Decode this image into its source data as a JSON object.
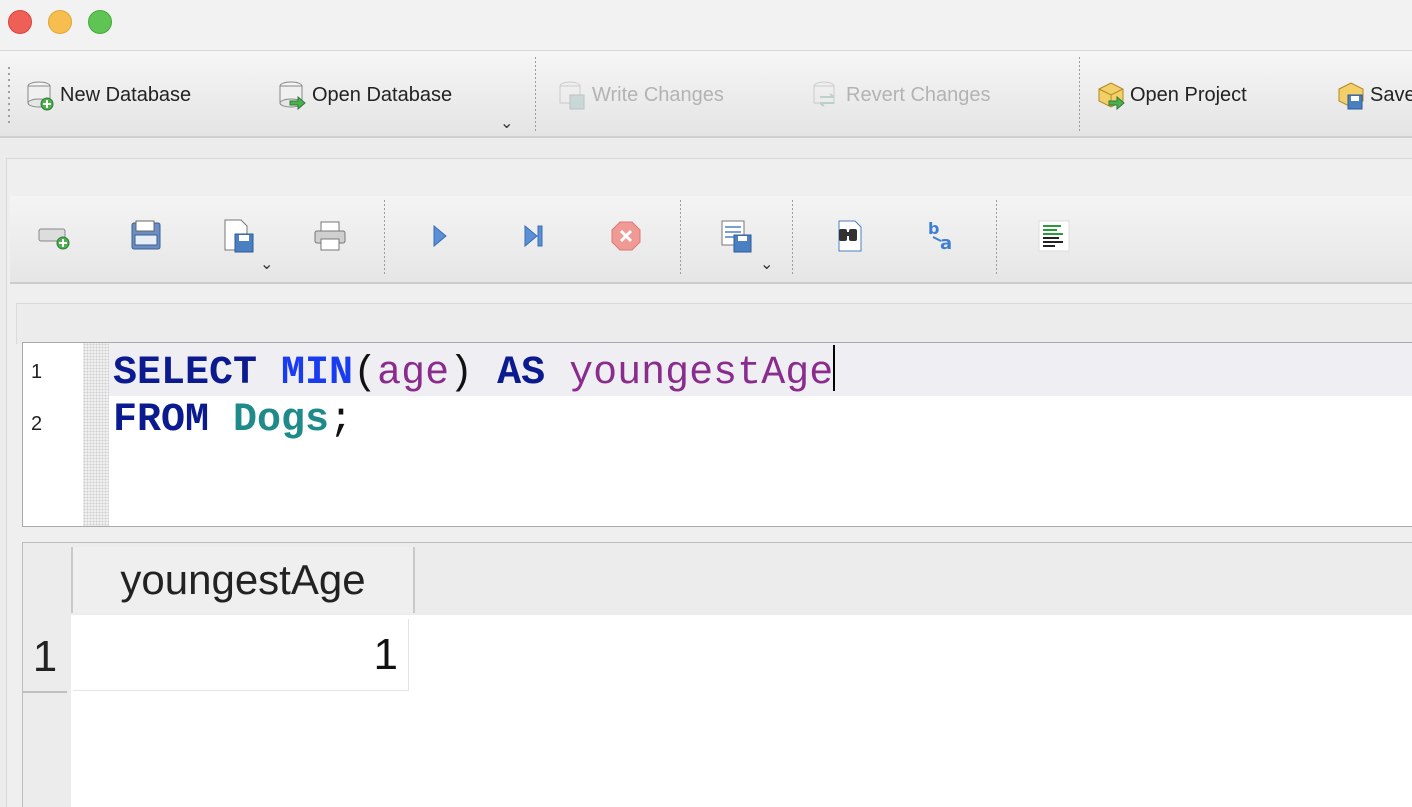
{
  "window": {
    "buttons": [
      "close",
      "minimize",
      "maximize"
    ]
  },
  "main_toolbar": {
    "new_database": "New Database",
    "open_database": "Open Database",
    "write_changes": "Write Changes",
    "revert_changes": "Revert Changes",
    "open_project": "Open Project",
    "save_project": "Save"
  },
  "sql_toolbar": {
    "icons": [
      "open-tab-icon",
      "open-sql-file-icon",
      "save-sql-file-icon",
      "print-icon",
      "execute-all-icon",
      "execute-line-icon",
      "stop-execution-icon",
      "save-results-icon",
      "find-icon",
      "find-replace-icon",
      "comment-icon"
    ]
  },
  "editor": {
    "line_numbers": [
      "1",
      "2"
    ],
    "line1": {
      "kw1": "SELECT",
      "fn": "MIN",
      "lp": "(",
      "arg": "age",
      "rp": ")",
      "kw2": "AS",
      "alias": "youngestAge"
    },
    "line2": {
      "kw": "FROM",
      "table": "Dogs",
      "semi": ";"
    }
  },
  "results": {
    "columns": [
      "youngestAge"
    ],
    "rows": [
      {
        "num": "1",
        "cells": [
          "1"
        ]
      }
    ]
  },
  "colors": {
    "keyword": "#0c1a8f",
    "function": "#1a3cf0",
    "identifier": "#8a2b8e",
    "table": "#1f8a8a"
  }
}
